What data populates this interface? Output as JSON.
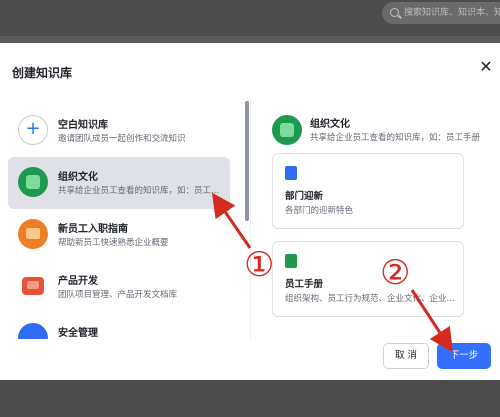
{
  "backdrop": {
    "search_placeholder": "搜索知识库、知识本、知识..."
  },
  "dialog": {
    "title": "创建知识库",
    "close_icon": "close-icon",
    "templates": [
      {
        "name": "空白知识库",
        "desc": "邀请团队成员一起创作和交流知识",
        "icon": "plus-icon",
        "selected": false
      },
      {
        "name": "组织文化",
        "desc": "共享给企业员工查看的知识库，如：员工...",
        "icon": "green-culture-icon",
        "selected": true
      },
      {
        "name": "新员工入职指南",
        "desc": "帮助新员工快速熟悉企业概要",
        "icon": "orange-onboarding-icon",
        "selected": false
      },
      {
        "name": "产品开发",
        "desc": "团队项目管理、产品开发文档库",
        "icon": "red-product-icon",
        "selected": false
      },
      {
        "name": "安全管理",
        "desc": "",
        "icon": "blue-security-icon",
        "selected": false
      }
    ],
    "preview": {
      "name": "组织文化",
      "desc": "共享给企业员工查看的知识库，如：员工手册",
      "pages": [
        {
          "title": "部门迎新",
          "desc": "各部门的迎新特色",
          "icon_color": "#2f6bf5"
        },
        {
          "title": "员工手册",
          "desc": "组织架构、员工行为规范、企业文化、企业...",
          "icon_color": "#1e9a50"
        }
      ]
    },
    "buttons": {
      "cancel": "取 消",
      "next": "下一步"
    }
  },
  "annotations": {
    "marker_1": "①",
    "marker_2": "②",
    "color": "#d42a1f"
  }
}
